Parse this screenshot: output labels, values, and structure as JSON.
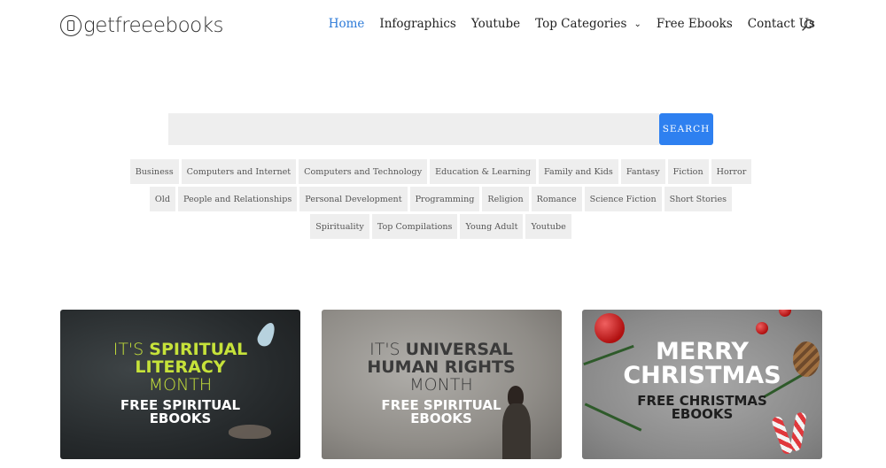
{
  "logo": {
    "text": "getfreeebooks"
  },
  "nav": {
    "items": [
      {
        "label": "Home",
        "active": true
      },
      {
        "label": "Infographics"
      },
      {
        "label": "Youtube"
      },
      {
        "label": "Top Categories",
        "has_dropdown": true
      },
      {
        "label": "Free Ebooks"
      },
      {
        "label": "Contact Us"
      }
    ],
    "search_icon": "search-icon",
    "accent_color": "#2e7bd8"
  },
  "search": {
    "value": "",
    "placeholder": "",
    "button_label": "SEARCH",
    "button_color": "#2e80f0"
  },
  "tags": [
    [
      "Business",
      "Computers and Internet",
      "Computers and Technology",
      "Education & Learning",
      "Family and Kids",
      "Fantasy",
      "Fiction",
      "Horror"
    ],
    [
      "Old",
      "People and Relationships",
      "Personal Development",
      "Programming",
      "Religion",
      "Romance",
      "Science Fiction",
      "Short Stories"
    ],
    [
      "Spirituality",
      "Top Compilations",
      "Young Adult",
      "Youtube"
    ]
  ],
  "cards": [
    {
      "lines": [
        {
          "parts": [
            {
              "text": "IT'S ",
              "color": "#c6e23a",
              "weight": "light"
            },
            {
              "text": "SPIRITUAL",
              "color": "#c6e23a",
              "weight": "bold"
            }
          ]
        },
        {
          "parts": [
            {
              "text": "LITERACY",
              "color": "#c6e23a",
              "weight": "bold"
            }
          ]
        },
        {
          "parts": [
            {
              "text": "MONTH",
              "color": "#c6e23a",
              "weight": "light"
            }
          ]
        },
        {
          "parts": [
            {
              "text": "FREE SPIRITUAL",
              "color": "#ffffff",
              "weight": "bold"
            }
          ]
        },
        {
          "parts": [
            {
              "text": "EBOOKS",
              "color": "#ffffff",
              "weight": "bold"
            }
          ]
        }
      ]
    },
    {
      "lines": [
        {
          "parts": [
            {
              "text": "IT'S ",
              "color": "#3a3a3a",
              "weight": "light"
            },
            {
              "text": "UNIVERSAL",
              "color": "#3a3a3a",
              "weight": "bold"
            }
          ]
        },
        {
          "parts": [
            {
              "text": "HUMAN RIGHTS",
              "color": "#3a3a3a",
              "weight": "bold"
            }
          ]
        },
        {
          "parts": [
            {
              "text": "MONTH",
              "color": "#3a3a3a",
              "weight": "light"
            }
          ]
        },
        {
          "parts": [
            {
              "text": "FREE SPIRITUAL",
              "color": "#ffffff",
              "weight": "bold"
            }
          ]
        },
        {
          "parts": [
            {
              "text": "EBOOKS",
              "color": "#ffffff",
              "weight": "bold"
            }
          ]
        }
      ]
    },
    {
      "lines": [
        {
          "parts": [
            {
              "text": "MERRY",
              "color": "#ffffff",
              "weight": "bold"
            }
          ]
        },
        {
          "parts": [
            {
              "text": "CHRISTMAS",
              "color": "#ffffff",
              "weight": "bold"
            }
          ]
        },
        {
          "parts": [
            {
              "text": "FREE CHRISTMAS",
              "color": "#1e1e1e",
              "weight": "bold"
            }
          ]
        },
        {
          "parts": [
            {
              "text": "EBOOKS",
              "color": "#1e1e1e",
              "weight": "bold"
            }
          ]
        }
      ]
    }
  ]
}
